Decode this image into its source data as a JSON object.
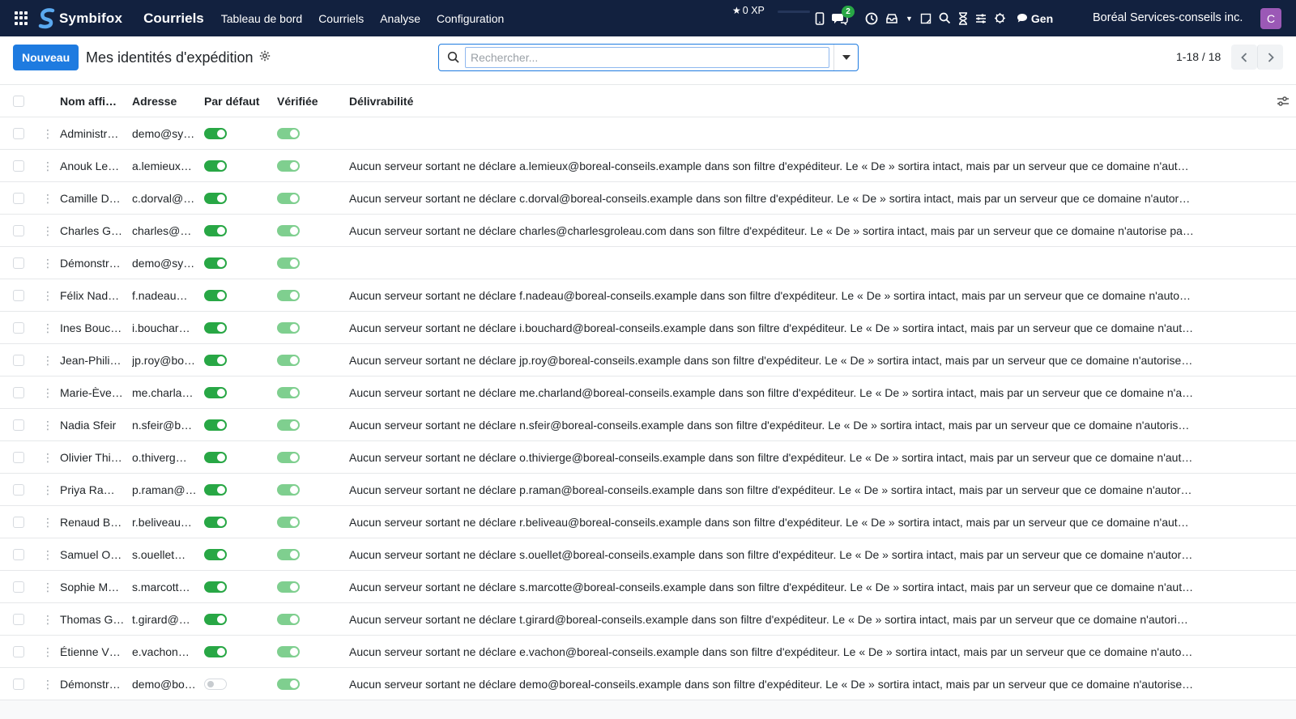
{
  "navbar": {
    "brand": "Symbifox",
    "app_title": "Courriels",
    "menu": [
      "Tableau de bord",
      "Courriels",
      "Analyse",
      "Configuration"
    ],
    "xp": "0 XP",
    "messages_badge": "2",
    "gen": "Gen",
    "company": "Boréal Services-conseils inc.",
    "avatar": "C"
  },
  "control": {
    "new_label": "Nouveau",
    "title": "Mes identités d'expédition",
    "search_placeholder": "Rechercher...",
    "pager": "1-18 / 18"
  },
  "table": {
    "headers": {
      "name": "Nom affi…",
      "address": "Adresse",
      "default": "Par défaut",
      "verified": "Vérifiée",
      "deliverability": "Délivrabilité"
    },
    "rows": [
      {
        "name": "Administr…",
        "address": "demo@sy…",
        "default": true,
        "verified": true,
        "deliverability": ""
      },
      {
        "name": "Anouk Le…",
        "address": "a.lemieux…",
        "default": true,
        "verified": true,
        "deliverability": "Aucun serveur sortant ne déclare a.lemieux@boreal-conseils.example dans son filtre d'expéditeur. Le « De » sortira intact, mais par un serveur que ce domaine n'aut…"
      },
      {
        "name": "Camille D…",
        "address": "c.dorval@…",
        "default": true,
        "verified": true,
        "deliverability": "Aucun serveur sortant ne déclare c.dorval@boreal-conseils.example dans son filtre d'expéditeur. Le « De » sortira intact, mais par un serveur que ce domaine n'autor…"
      },
      {
        "name": "Charles G…",
        "address": "charles@c…",
        "default": true,
        "verified": true,
        "deliverability": "Aucun serveur sortant ne déclare charles@charlesgroleau.com dans son filtre d'expéditeur. Le « De » sortira intact, mais par un serveur que ce domaine n'autorise pa…"
      },
      {
        "name": "Démonstr…",
        "address": "demo@sy…",
        "default": true,
        "verified": true,
        "deliverability": ""
      },
      {
        "name": "Félix Nad…",
        "address": "f.nadeau…",
        "default": true,
        "verified": true,
        "deliverability": "Aucun serveur sortant ne déclare f.nadeau@boreal-conseils.example dans son filtre d'expéditeur. Le « De » sortira intact, mais par un serveur que ce domaine n'auto…"
      },
      {
        "name": "Ines Bouc…",
        "address": "i.bouchar…",
        "default": true,
        "verified": true,
        "deliverability": "Aucun serveur sortant ne déclare i.bouchard@boreal-conseils.example dans son filtre d'expéditeur. Le « De » sortira intact, mais par un serveur que ce domaine n'aut…"
      },
      {
        "name": "Jean-Phili…",
        "address": "jp.roy@bo…",
        "default": true,
        "verified": true,
        "deliverability": "Aucun serveur sortant ne déclare jp.roy@boreal-conseils.example dans son filtre d'expéditeur. Le « De » sortira intact, mais par un serveur que ce domaine n'autorise…"
      },
      {
        "name": "Marie-Ève…",
        "address": "me.charla…",
        "default": true,
        "verified": true,
        "deliverability": "Aucun serveur sortant ne déclare me.charland@boreal-conseils.example dans son filtre d'expéditeur. Le « De » sortira intact, mais par un serveur que ce domaine n'a…"
      },
      {
        "name": "Nadia Sfeir",
        "address": "n.sfeir@b…",
        "default": true,
        "verified": true,
        "deliverability": "Aucun serveur sortant ne déclare n.sfeir@boreal-conseils.example dans son filtre d'expéditeur. Le « De » sortira intact, mais par un serveur que ce domaine n'autoris…"
      },
      {
        "name": "Olivier Thi…",
        "address": "o.thiverg…",
        "default": true,
        "verified": true,
        "deliverability": "Aucun serveur sortant ne déclare o.thivierge@boreal-conseils.example dans son filtre d'expéditeur. Le « De » sortira intact, mais par un serveur que ce domaine n'aut…"
      },
      {
        "name": "Priya Ra…",
        "address": "p.raman@…",
        "default": true,
        "verified": true,
        "deliverability": "Aucun serveur sortant ne déclare p.raman@boreal-conseils.example dans son filtre d'expéditeur. Le « De » sortira intact, mais par un serveur que ce domaine n'autor…"
      },
      {
        "name": "Renaud B…",
        "address": "r.beliveau…",
        "default": true,
        "verified": true,
        "deliverability": "Aucun serveur sortant ne déclare r.beliveau@boreal-conseils.example dans son filtre d'expéditeur. Le « De » sortira intact, mais par un serveur que ce domaine n'aut…"
      },
      {
        "name": "Samuel O…",
        "address": "s.ouellet@…",
        "default": true,
        "verified": true,
        "deliverability": "Aucun serveur sortant ne déclare s.ouellet@boreal-conseils.example dans son filtre d'expéditeur. Le « De » sortira intact, mais par un serveur que ce domaine n'autor…"
      },
      {
        "name": "Sophie M…",
        "address": "s.marcott…",
        "default": true,
        "verified": true,
        "deliverability": "Aucun serveur sortant ne déclare s.marcotte@boreal-conseils.example dans son filtre d'expéditeur. Le « De » sortira intact, mais par un serveur que ce domaine n'aut…"
      },
      {
        "name": "Thomas G…",
        "address": "t.girard@…",
        "default": true,
        "verified": true,
        "deliverability": "Aucun serveur sortant ne déclare t.girard@boreal-conseils.example dans son filtre d'expéditeur. Le « De » sortira intact, mais par un serveur que ce domaine n'autori…"
      },
      {
        "name": "Étienne V…",
        "address": "e.vachon…",
        "default": true,
        "verified": true,
        "deliverability": "Aucun serveur sortant ne déclare e.vachon@boreal-conseils.example dans son filtre d'expéditeur. Le « De » sortira intact, mais par un serveur que ce domaine n'auto…"
      },
      {
        "name": "Démonstr…",
        "address": "demo@bo…",
        "default": false,
        "verified": true,
        "deliverability": "Aucun serveur sortant ne déclare demo@boreal-conseils.example dans son filtre d'expéditeur. Le « De » sortira intact, mais par un serveur que ce domaine n'autorise…"
      }
    ]
  },
  "colors": {
    "navbar_bg": "#12213f",
    "primary": "#1e7be0",
    "toggle_on": "#28a745",
    "toggle_verified": "#7fcf8f",
    "avatar": "#9b59b6"
  }
}
